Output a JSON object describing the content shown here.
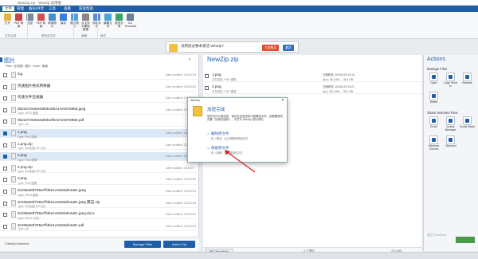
{
  "window": {
    "title": "NewZip.zip - WinZip 试用版"
  },
  "ribbon_tabs": [
    "文件",
    "管理",
    "备份/共享",
    "工具",
    "查看",
    "获取帮助"
  ],
  "ribbon_buttons": [
    {
      "label": "打开",
      "color": "#e4b44a"
    },
    {
      "label": "PDF 转换",
      "color": "#c94545"
    },
    {
      "label": "加密",
      "color": "#7a8ba0"
    },
    {
      "label": "PDF 转换",
      "color": "#d15050"
    },
    {
      "label": "转换照片",
      "color": "#4a90c8"
    },
    {
      "label": "保存",
      "color": "#3b7dd8"
    },
    {
      "label": "缩小照片",
      "color": "#5aa0d0"
    },
    {
      "label": "从文件中删除数据",
      "color": "#888888"
    },
    {
      "label": "添加水印",
      "color": "#5b8fd4"
    },
    {
      "label": "编辑文件",
      "color": "#4aa6d6"
    },
    {
      "label": "更改分享",
      "color": "#3aa56a"
    },
    {
      "label": "UU Encoded",
      "color": "#6a7f98"
    }
  ],
  "ribbon_groups": [
    "文件应用",
    "图形的文件",
    "编辑",
    "格式"
  ],
  "ad": {
    "text": "试用前必要本激活 WinZip?",
    "btn1": "立即购买",
    "btn2": "激活"
  },
  "left": {
    "title": "图片",
    "path": "Files › 此电脑 › 图片 › tools › 桌面",
    "footer_info": "2 item(s) selected",
    "manage_btn": "Manage Files",
    "add_btn": "Add to Zip",
    "files": [
      {
        "name": "log",
        "type": "",
        "date": "Date modified: 2023/1/28",
        "checked": false,
        "sel": false
      },
      {
        "name": "优速图片格式转换器",
        "type": "",
        "date": "Date modified: 2023/1/28",
        "checked": false,
        "sel": false
      },
      {
        "name": "优速文件压缩器",
        "type": "",
        "date": "Date modified: 2023/1/28",
        "checked": false,
        "sel": false
      },
      {
        "name": "0b22372e92e83b9e2f6417e0378958.jpeg",
        "type": "Type: JPEG 图像",
        "date": "Date modified: 2023/1/17",
        "checked": false,
        "sel": false
      },
      {
        "name": "0b22372e92e83b9e2f6417e0378958.pdf",
        "type": "Type: pdf",
        "date": "",
        "checked": false,
        "sel": false
      },
      {
        "name": "1.png",
        "type": "Type: PNG 图像",
        "date": "Date modified: 2023/1/29",
        "checked": true,
        "sel": true
      },
      {
        "name": "1.png.zip",
        "type": "Type: 360压缩 ZIP 文件",
        "date": "Date modified: 2023/1/29",
        "checked": false,
        "sel": false
      },
      {
        "name": "2.png",
        "type": "Type: PNG 图像",
        "date": "Date modified: 2023/1/29",
        "checked": true,
        "sel": true
      },
      {
        "name": "2.png.zip",
        "type": "Type: 360压缩 ZIP 文件",
        "date": "Date modified: 2023/1/7",
        "checked": false,
        "sel": false
      },
      {
        "name": "3.png",
        "type": "Type: PNG 图像",
        "date": "Date modified: 2023/1/28",
        "checked": false,
        "sel": false
      },
      {
        "name": "3c038a94f765a7ff4be1c6463afe2a9c.jpeg",
        "type": "Type: JPEG 图像",
        "date": "Date modified: 2023/1/28",
        "checked": false,
        "sel": false
      },
      {
        "name": "3c038a94f765a7ff4be1c6463afe2a9c.jpeg 属压.zip",
        "type": "Type: 360压缩 ZIP 文件",
        "date": "Date modified: 2023/1/28",
        "checked": false,
        "sel": false
      },
      {
        "name": "3c038a94f765a7ff4be1c6463afe2a9c.jpeg.docx",
        "type": "Type: DOCX 文档",
        "date": "Date modified: 2023/1/28",
        "checked": false,
        "sel": false
      },
      {
        "name": "3c038a94f765a7ff4be1c6463afe2a9c.pdf",
        "type": "Type: pdf",
        "date": "Date modified: 2023/1/28",
        "checked": false,
        "sel": false
      }
    ]
  },
  "middle": {
    "title": "NewZip.zip",
    "zipfiles": [
      {
        "name": "1.png",
        "type": "文件类型: PNG 图像",
        "date": "日期修改: 2023/1/29 13:10",
        "size": "大小: 33.1 KB → 33.1 KB"
      },
      {
        "name": "2.png",
        "type": "文件类型: PNG 图像",
        "date": "日期修改: 2023/1/29 13:21",
        "size": "大小: 33.1 KB → 33.1 KB"
      }
    ],
    "footer": {
      "unzip": "解压到文件夹",
      "items": "2 个项目",
      "size": "70.1 KB"
    }
  },
  "dialog": {
    "title": "WinZip",
    "heading": "加密完成",
    "message": "您的文件已被加密，请记住加密密码才能解密文件。如需要修改设置（如添加密码），可打开 WinZip 进行修改。",
    "opt1_title": "删除原文件",
    "opt1_sub": "是（建议）后立即删除原始文件",
    "opt2_title": "保留原文件",
    "opt2_sub": "是（推荐）保留原始的文件"
  },
  "right": {
    "title": "Actions",
    "manage_title": "Manage Files",
    "manage_actions": [
      "Open",
      "Copy/ Move to",
      "Rename",
      "Delete"
    ],
    "share_title": "Share Selected Files",
    "share_actions": [
      "Email",
      "Instant Message",
      "Social Media",
      "Windows Charms",
      "Clipboard"
    ]
  },
  "watermark": "激活 Windows"
}
